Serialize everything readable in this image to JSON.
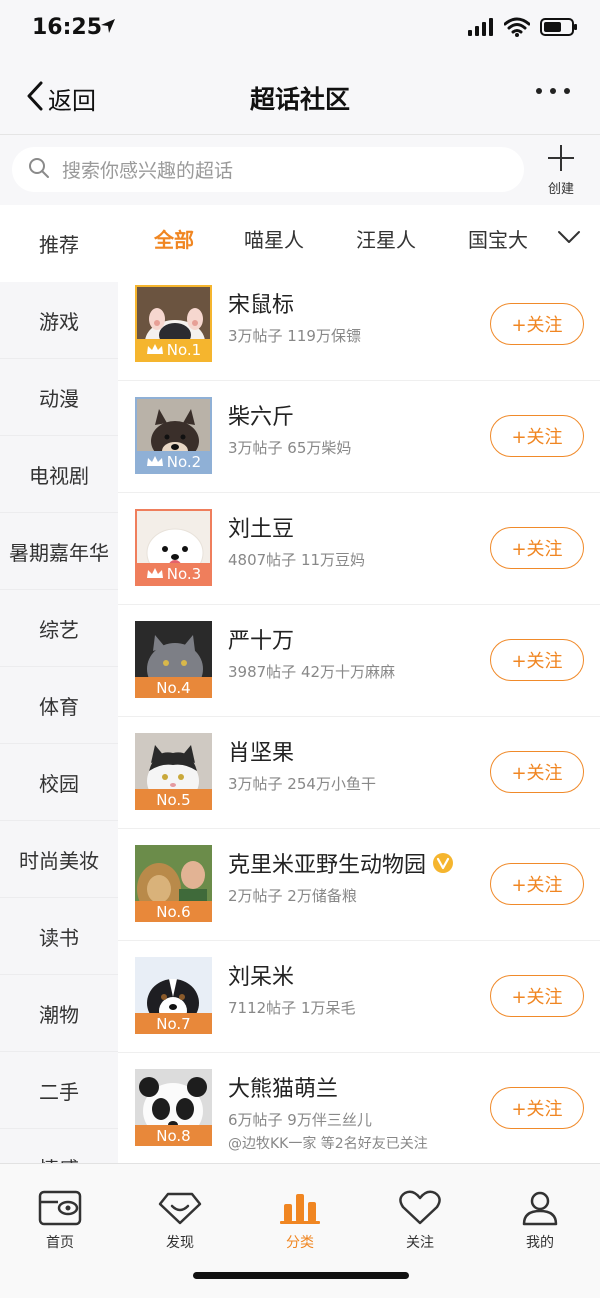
{
  "status_bar": {
    "time": "16:25"
  },
  "header": {
    "back_label": "返回",
    "title": "超话社区"
  },
  "search": {
    "placeholder": "搜索你感兴趣的超话",
    "create_label": "创建"
  },
  "sidebar": {
    "items": [
      {
        "label": "推荐"
      },
      {
        "label": "游戏"
      },
      {
        "label": "动漫"
      },
      {
        "label": "电视剧"
      },
      {
        "label": "暑期嘉年华"
      },
      {
        "label": "综艺"
      },
      {
        "label": "体育"
      },
      {
        "label": "校园"
      },
      {
        "label": "时尚美妆"
      },
      {
        "label": "读书"
      },
      {
        "label": "潮物"
      },
      {
        "label": "二手"
      },
      {
        "label": "情感"
      }
    ]
  },
  "tabs": [
    {
      "label": "全部"
    },
    {
      "label": "喵星人"
    },
    {
      "label": "汪星人"
    },
    {
      "label": "国宝大"
    }
  ],
  "list": [
    {
      "rank": "No.1",
      "name": "宋鼠标",
      "stats": "3万帖子 119万保镖",
      "follow": "+关注"
    },
    {
      "rank": "No.2",
      "name": "柴六斤",
      "stats": "3万帖子 65万柴妈",
      "follow": "+关注"
    },
    {
      "rank": "No.3",
      "name": "刘土豆",
      "stats": "4807帖子 11万豆妈",
      "follow": "+关注"
    },
    {
      "rank": "No.4",
      "name": "严十万",
      "stats": "3987帖子 42万十万麻麻",
      "follow": "+关注"
    },
    {
      "rank": "No.5",
      "name": "肖坚果",
      "stats": "3万帖子 254万小鱼干",
      "follow": "+关注"
    },
    {
      "rank": "No.6",
      "name": "克里米亚野生动物园",
      "stats": "2万帖子 2万储备粮",
      "follow": "+关注"
    },
    {
      "rank": "No.7",
      "name": "刘呆米",
      "stats": "7112帖子 1万呆毛",
      "follow": "+关注"
    },
    {
      "rank": "No.8",
      "name": "大熊猫萌兰",
      "stats": "6万帖子 9万伴三丝儿",
      "friends": "@边牧KK一家 等2名好友已关注",
      "follow": "+关注"
    }
  ],
  "bottom_tabs": [
    {
      "label": "首页"
    },
    {
      "label": "发现"
    },
    {
      "label": "分类"
    },
    {
      "label": "关注"
    },
    {
      "label": "我的"
    }
  ],
  "colors": {
    "accent": "#f08622",
    "rank_gold": "#f5b52e",
    "rank_silver": "#8fb0d6",
    "rank_bronze": "#ef7e5c",
    "rank_default": "#e8883a"
  }
}
